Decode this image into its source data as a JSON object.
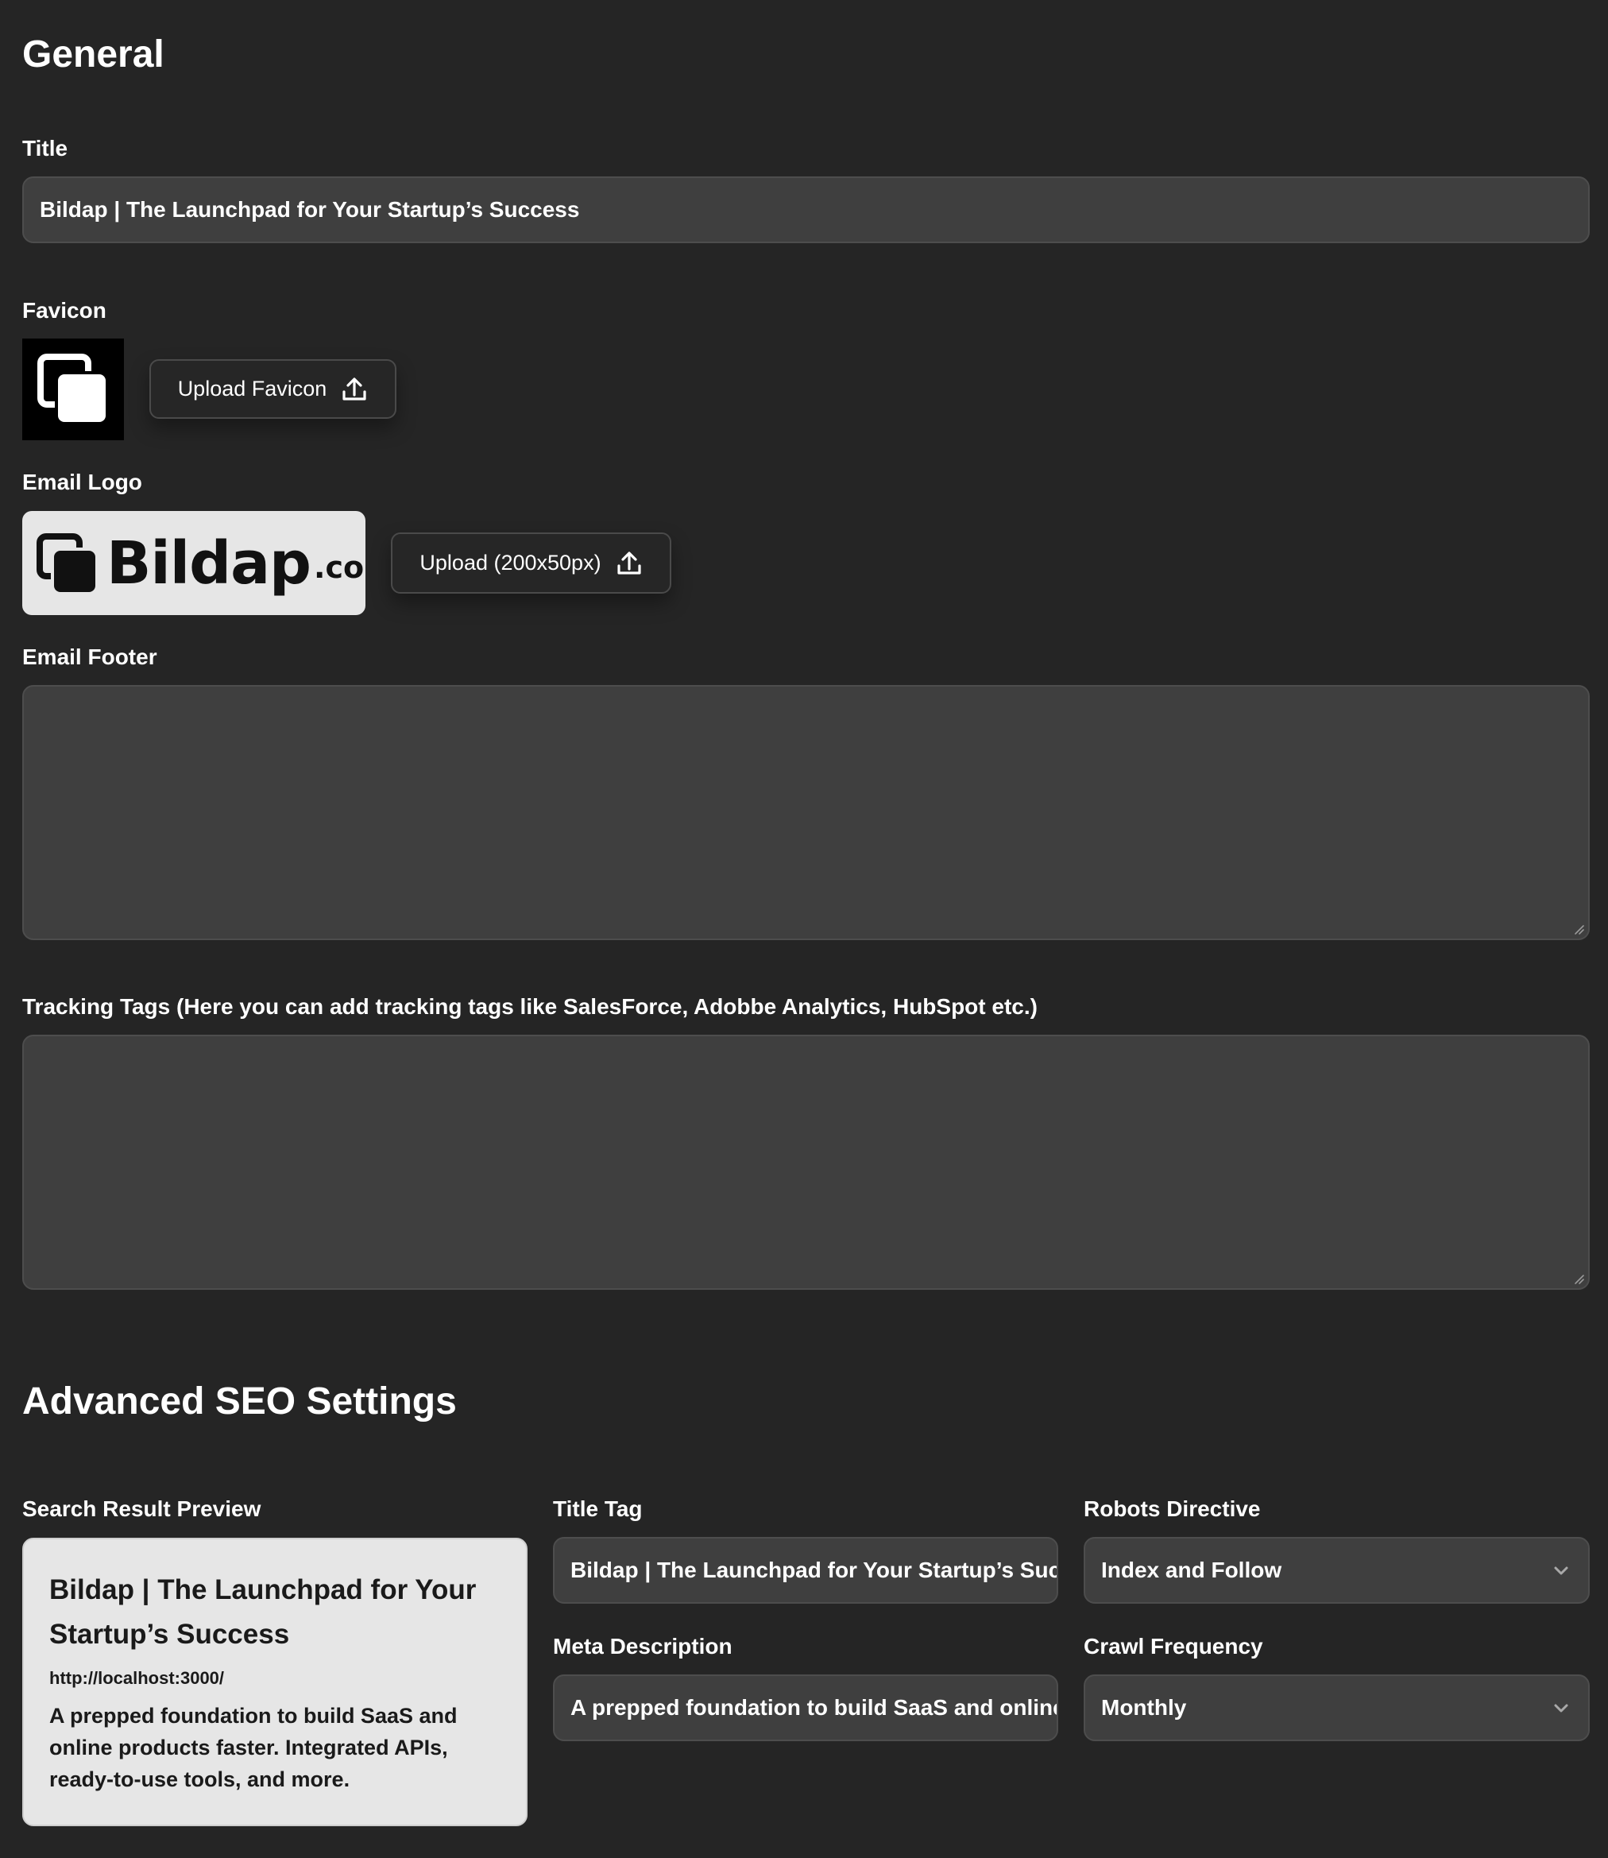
{
  "general": {
    "heading": "General",
    "title_label": "Title",
    "title_value": "Bildap | The Launchpad for Your Startup’s Success",
    "favicon_label": "Favicon",
    "upload_favicon_label": "Upload Favicon",
    "email_logo_label": "Email Logo",
    "email_logo_brand": "Bildap",
    "email_logo_tld": ".co",
    "upload_logo_label": "Upload (200x50px)",
    "email_footer_label": "Email Footer",
    "email_footer_value": "",
    "tracking_tags_label": "Tracking Tags (Here you can add tracking tags like SalesForce, Adobbe Analytics, HubSpot etc.)",
    "tracking_tags_value": ""
  },
  "seo": {
    "heading": "Advanced SEO Settings",
    "preview_label": "Search Result Preview",
    "preview": {
      "title": "Bildap | The Launchpad for Your Startup’s Success",
      "url": "http://localhost:3000/",
      "description": "A prepped foundation to build SaaS and online products faster. Integrated APIs, ready-to-use tools, and more."
    },
    "title_tag_label": "Title Tag",
    "title_tag_value": "Bildap | The Launchpad for Your Startup’s Success",
    "meta_description_label": "Meta Description",
    "meta_description_value": "A prepped foundation to build SaaS and online products faster. Integrated APIs, ready-to-use tools, and more.",
    "robots_label": "Robots Directive",
    "robots_value": "Index and Follow",
    "crawl_label": "Crawl Frequency",
    "crawl_value": "Monthly"
  },
  "icons": {
    "upload": "upload-icon",
    "chevron": "chevron-down-icon",
    "favicon": "stacked-squares-icon"
  },
  "colors": {
    "background": "#252525",
    "input_bg": "#3f3f3f",
    "card_bg": "#e6e6e6"
  }
}
